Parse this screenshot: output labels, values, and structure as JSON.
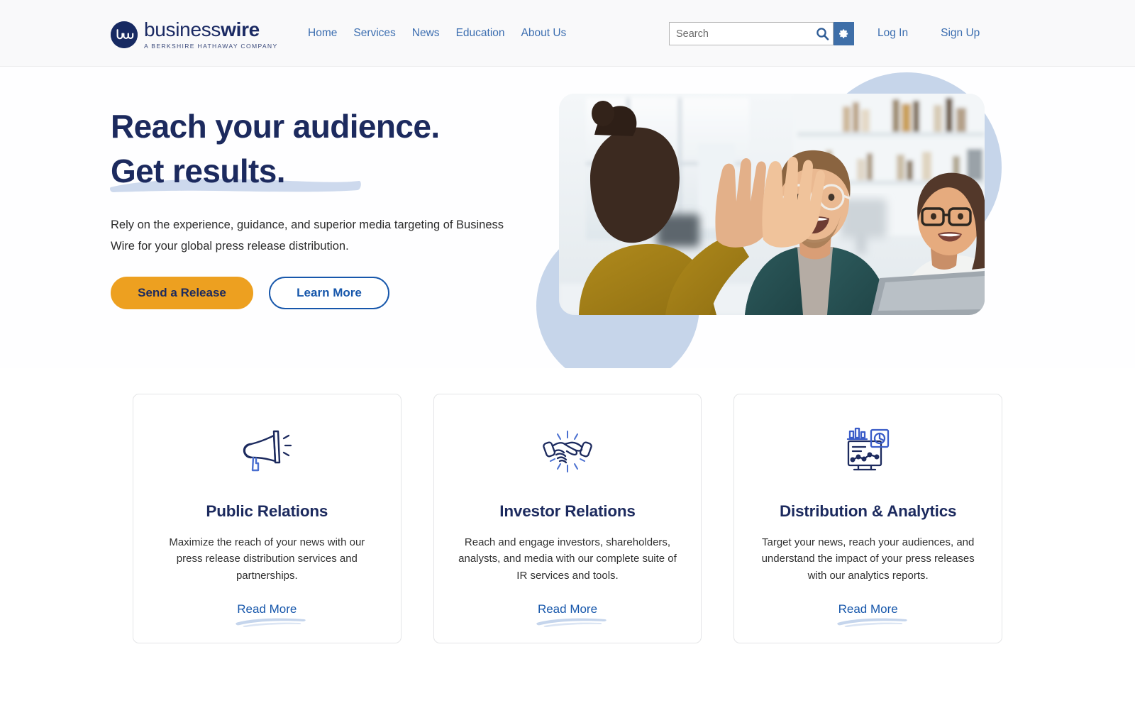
{
  "header": {
    "logo": {
      "mark_text": "bw",
      "word_part1": "business",
      "word_part2": "wire",
      "tagline": "A BERKSHIRE HATHAWAY COMPANY"
    },
    "nav": [
      {
        "label": "Home",
        "name": "home"
      },
      {
        "label": "Services",
        "name": "services"
      },
      {
        "label": "News",
        "name": "news"
      },
      {
        "label": "Education",
        "name": "education"
      },
      {
        "label": "About Us",
        "name": "about-us"
      }
    ],
    "search": {
      "placeholder": "Search",
      "value": "",
      "submit_icon": "search-icon",
      "settings_icon": "gear-icon"
    },
    "account": [
      {
        "label": "Log In",
        "name": "log-in"
      },
      {
        "label": "Sign Up",
        "name": "sign-up"
      }
    ]
  },
  "hero": {
    "title_line1": "Reach your audience.",
    "title_line2": "Get results.",
    "subtitle": "Rely on the experience, guidance, and superior media targeting of Business Wire for your global press release distribution.",
    "primary_button": "Send a Release",
    "secondary_button": "Learn More",
    "image_alt": "Colleagues high-fiving in a bright office"
  },
  "cards": [
    {
      "icon": "megaphone-icon",
      "title": "Public Relations",
      "body": "Maximize the reach of your news with our press release distribution services and partnerships.",
      "link": "Read More"
    },
    {
      "icon": "handshake-icon",
      "title": "Investor Relations",
      "body": "Reach and engage investors, shareholders, analysts, and media with our complete suite of IR services and tools.",
      "link": "Read More"
    },
    {
      "icon": "analytics-dashboard-icon",
      "title": "Distribution & Analytics",
      "body": "Target your news, reach your audiences, and understand the impact of your press releases with our analytics reports.",
      "link": "Read More"
    }
  ],
  "colors": {
    "brand_navy": "#1c2a5e",
    "link_blue": "#1757ab",
    "nav_blue": "#3c6eb0",
    "accent_orange": "#eda020",
    "blob_blue": "#c6d5ea",
    "header_bg": "#f9f9fa"
  }
}
